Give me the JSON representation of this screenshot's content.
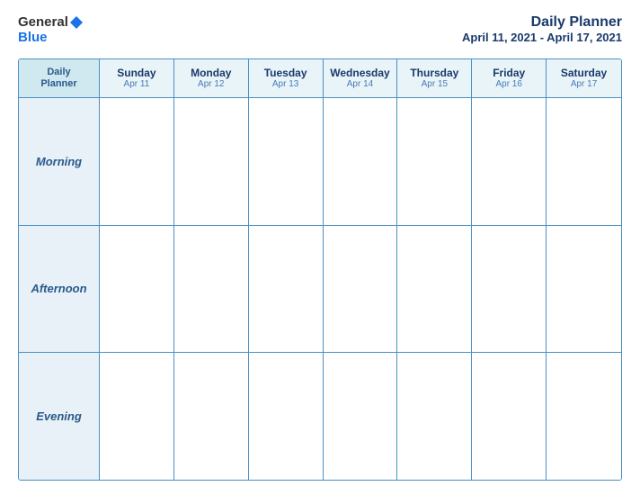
{
  "header": {
    "logo": {
      "line1": "General",
      "line2": "Blue"
    },
    "title": "Daily Planner",
    "subtitle": "April 11, 2021 - April 17, 2021"
  },
  "calendar": {
    "firstCol": {
      "line1": "Daily",
      "line2": "Planner"
    },
    "columns": [
      {
        "day": "Sunday",
        "date": "Apr 11"
      },
      {
        "day": "Monday",
        "date": "Apr 12"
      },
      {
        "day": "Tuesday",
        "date": "Apr 13"
      },
      {
        "day": "Wednesday",
        "date": "Apr 14"
      },
      {
        "day": "Thursday",
        "date": "Apr 15"
      },
      {
        "day": "Friday",
        "date": "Apr 16"
      },
      {
        "day": "Saturday",
        "date": "Apr 17"
      }
    ],
    "rows": [
      {
        "label": "Morning"
      },
      {
        "label": "Afternoon"
      },
      {
        "label": "Evening"
      }
    ]
  }
}
